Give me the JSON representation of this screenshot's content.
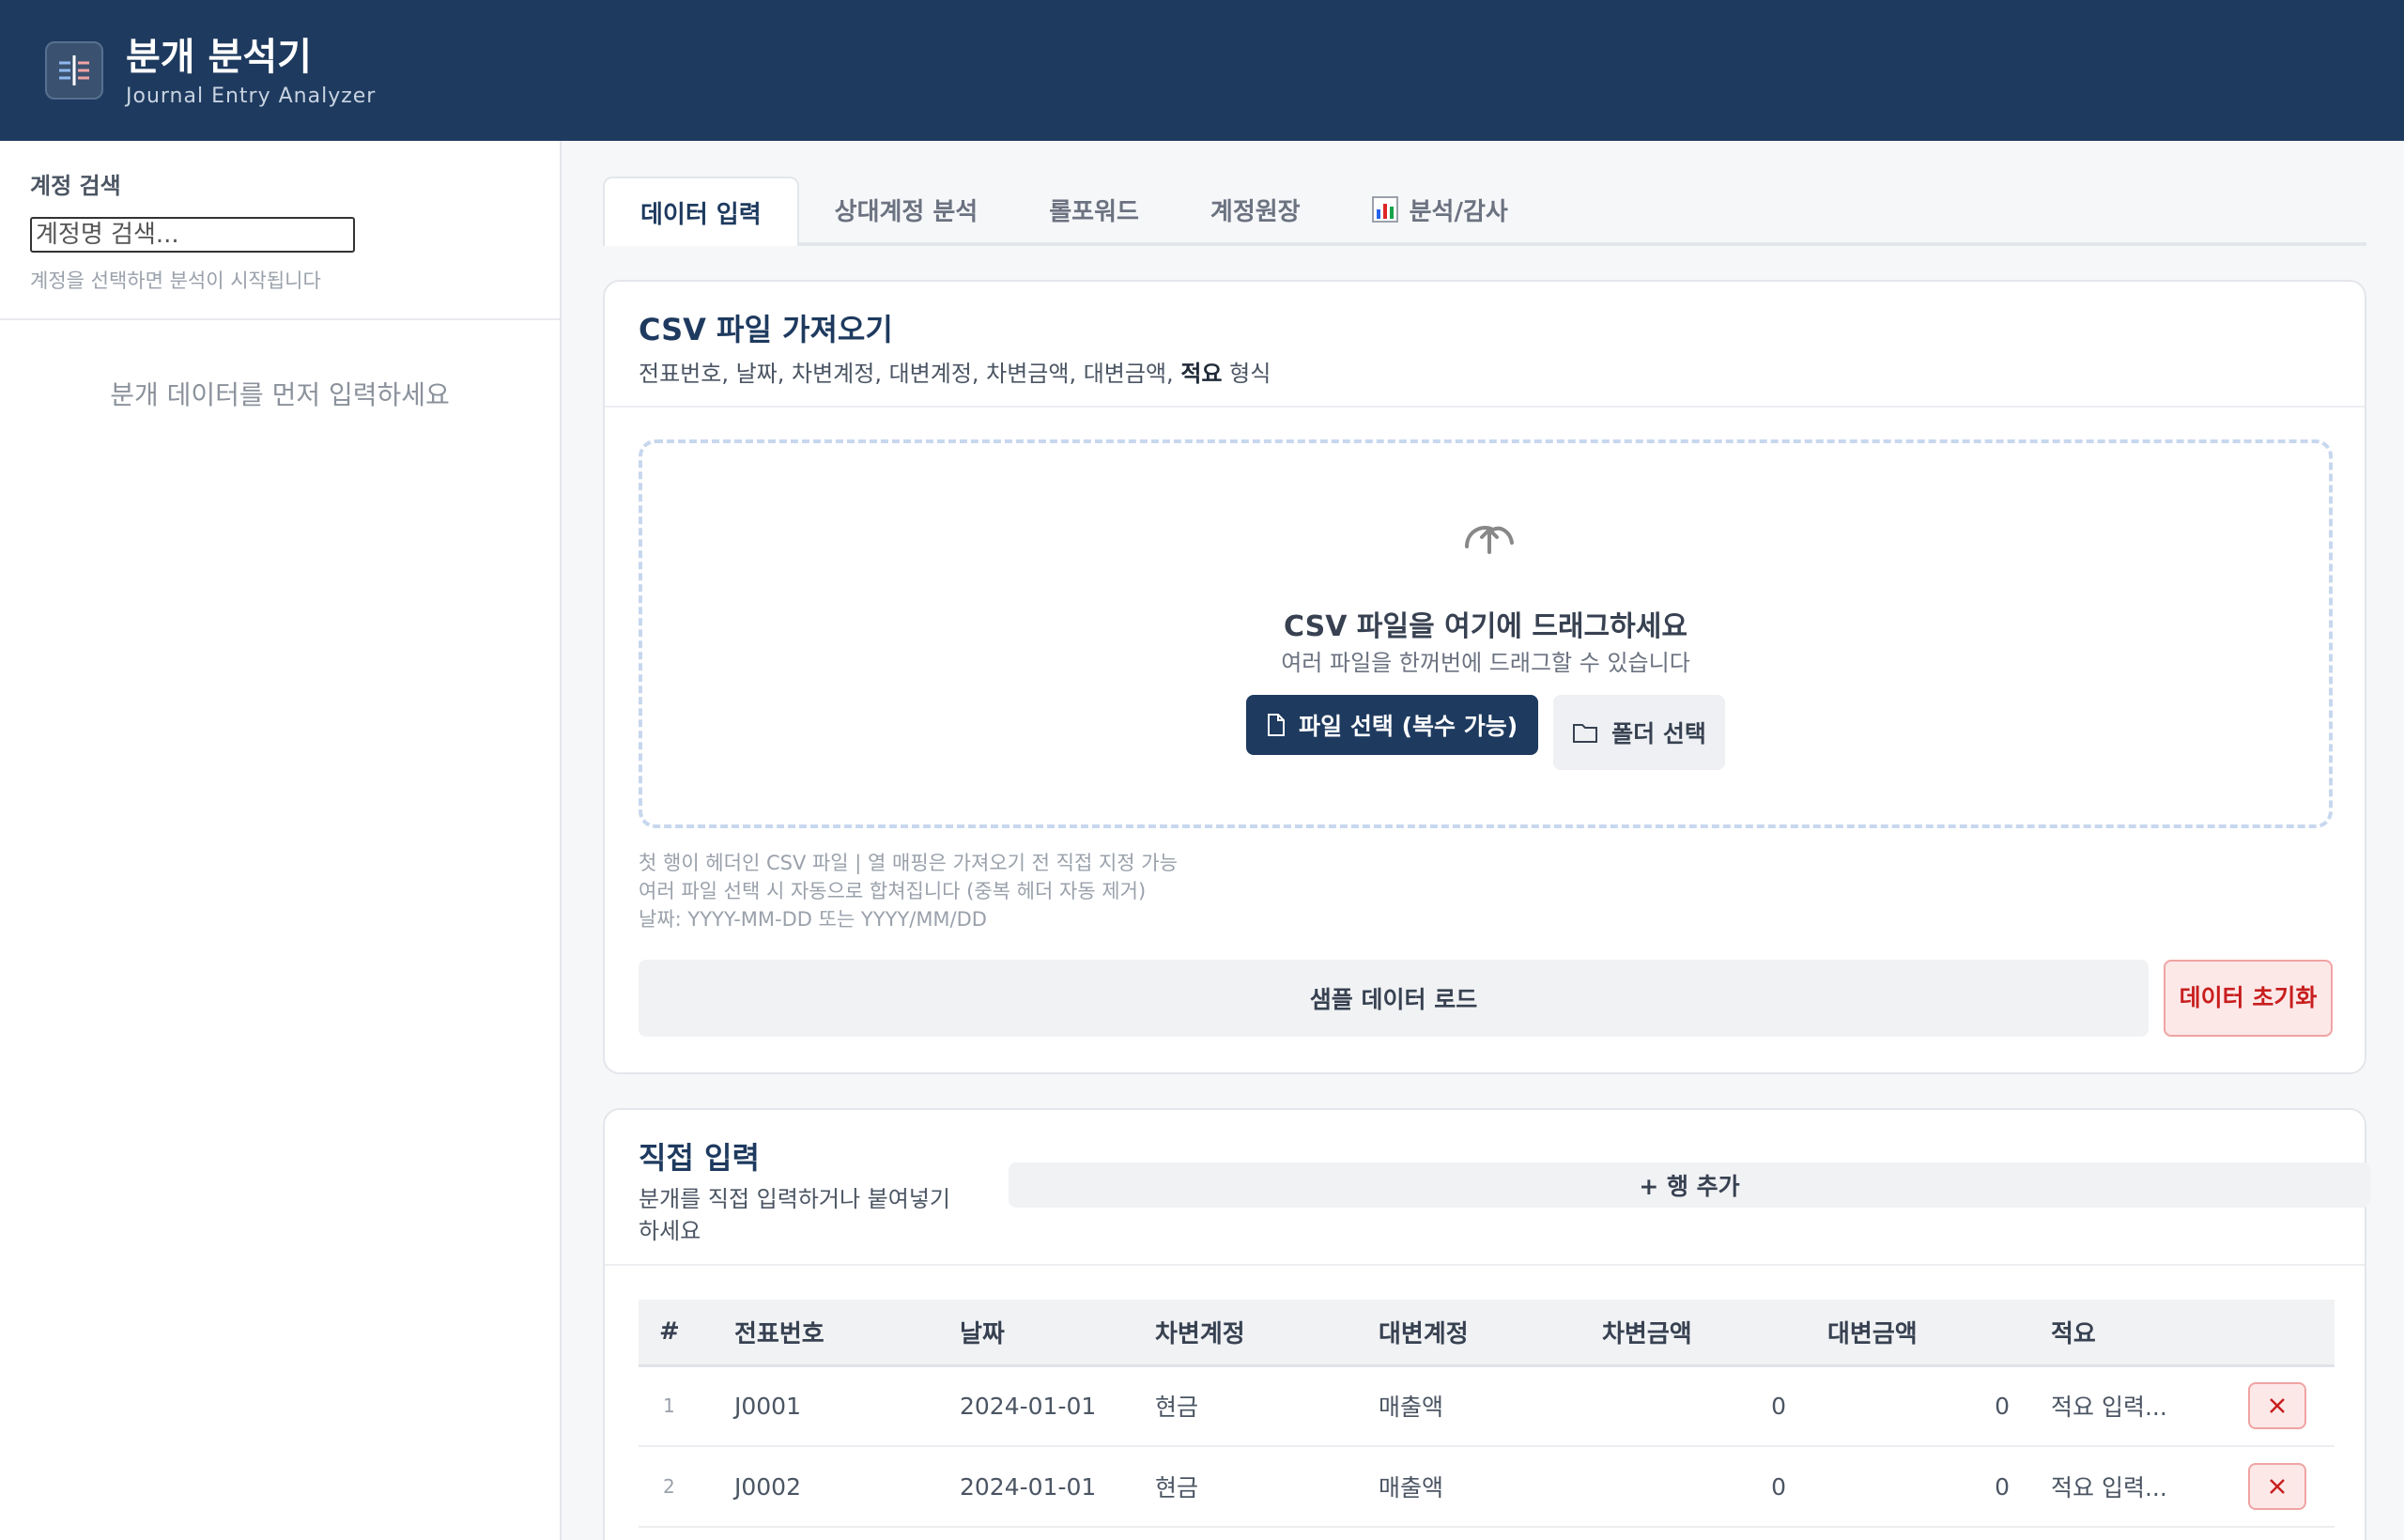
{
  "app": {
    "title": "분개 분석기",
    "subtitle": "Journal Entry Analyzer",
    "logo_icon": "ledger-icon"
  },
  "sidebar": {
    "search_label": "계정 검색",
    "search_placeholder": "계정명 검색...",
    "hint": "계정을 선택하면 분석이 시작됩니다",
    "empty_message": "분개 데이터를 먼저 입력하세요"
  },
  "tabs": [
    {
      "label": "데이터 입력",
      "active": true
    },
    {
      "label": "상대계정 분석",
      "active": false
    },
    {
      "label": "롤포워드",
      "active": false
    },
    {
      "label": "계정원장",
      "active": false
    },
    {
      "label": "분석/감사",
      "active": false,
      "icon": "bar-chart-icon"
    }
  ],
  "csv_import": {
    "title": "CSV 파일 가져오기",
    "desc_prefix": "전표번호, 날짜, 차변계정, 대변계정, 차변금액, 대변금액,",
    "desc_bold": "적요",
    "desc_suffix": "형식",
    "dropzone_icon": "upload-cloud-icon",
    "dropzone_title": "CSV 파일을 여기에 드래그하세요",
    "dropzone_sub": "여러 파일을 한꺼번에 드래그할 수 있습니다",
    "file_button": "파일 선택 (복수 가능)",
    "folder_button": "폴더 선택",
    "notes": [
      "첫 행이 헤더인 CSV 파일 | 열 매핑은 가져오기 전 직접 지정 가능",
      "여러 파일 선택 시 자동으로 합쳐집니다 (중복 헤더 자동 제거)",
      "날짜: YYYY-MM-DD 또는 YYYY/MM/DD"
    ],
    "sample_button": "샘플 데이터 로드",
    "reset_button": "데이터 초기화"
  },
  "direct_input": {
    "title": "직접 입력",
    "desc": "분개를 직접 입력하거나 붙여넣기 하세요",
    "add_row_button": "+ 행 추가",
    "columns": [
      "#",
      "전표번호",
      "날짜",
      "차변계정",
      "대변계정",
      "차변금액",
      "대변금액",
      "적요"
    ],
    "rows": [
      {
        "idx": "1",
        "voucher": "J0001",
        "date": "2024-01-01",
        "debit_account": "현금",
        "credit_account": "매출액",
        "debit_amount": "0",
        "credit_amount": "0",
        "memo": "적요 입력..."
      },
      {
        "idx": "2",
        "voucher": "J0002",
        "date": "2024-01-01",
        "debit_account": "현금",
        "credit_account": "매출액",
        "debit_amount": "0",
        "credit_amount": "0",
        "memo": "적요 입력..."
      }
    ]
  },
  "colors": {
    "header_bg": "#1e3a5f",
    "danger": "#c81e1e",
    "danger_bg": "#fde8e8"
  }
}
